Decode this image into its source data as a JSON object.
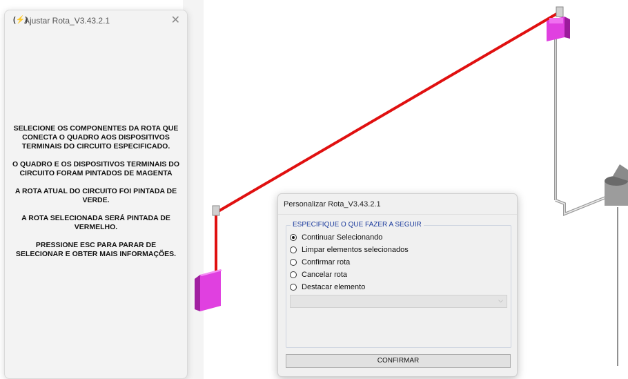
{
  "side_panel": {
    "icon_glyph": "(⚡)",
    "title": "Ajustar Rota_V3.43.2.1",
    "close_glyph": "✕",
    "instructions": [
      "SELECIONE OS COMPONENTES DA ROTA QUE CONECTA O QUADRO AOS DISPOSITIVOS TERMINAIS DO CIRCUITO ESPECIFICADO.",
      "O QUADRO E OS DISPOSITIVOS TERMINAIS DO CIRCUITO FORAM PINTADOS DE MAGENTA",
      "A ROTA ATUAL DO CIRCUITO FOI PINTADA DE VERDE.",
      "A ROTA SELECIONADA SERÁ PINTADA DE VERMELHO.",
      "PRESSIONE ESC PARA PARAR DE SELECIONAR E OBTER MAIS INFORMAÇÕES."
    ]
  },
  "dialog": {
    "title": "Personalizar Rota_V3.43.2.1",
    "group_label": "ESPECIFIQUE O QUE FAZER A SEGUIR",
    "options": [
      {
        "label": "Continuar Selecionando",
        "checked": true
      },
      {
        "label": "Limpar elementos selecionados",
        "checked": false
      },
      {
        "label": "Confirmar rota",
        "checked": false
      },
      {
        "label": "Cancelar rota",
        "checked": false
      },
      {
        "label": "Destacar elemento",
        "checked": false
      }
    ],
    "combo_value": "",
    "confirm_label": "CONFIRMAR"
  },
  "colors": {
    "route_selected": "#e01010",
    "terminal_device": "#e040e0",
    "conduit": "#b0b0b0"
  },
  "icons": [
    "app-icon",
    "close-icon",
    "chevron-down-icon"
  ]
}
